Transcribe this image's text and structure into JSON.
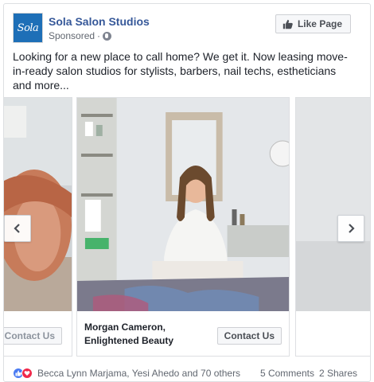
{
  "header": {
    "page_name": "Sola Salon Studios",
    "avatar_text": "Sola",
    "sponsored": "Sponsored",
    "separator": "·",
    "like_page_label": "Like Page"
  },
  "post_text": "Looking for a new place to call home? We get it. Now leasing move-in-ready salon studios for stylists, barbers, nail techs, estheticians and more...",
  "carousel": {
    "cards": [
      {
        "title": "",
        "button": "Contact Us"
      },
      {
        "title": "Morgan Cameron, Enlightened Beauty",
        "button": "Contact Us"
      },
      {
        "title": "",
        "button": ""
      }
    ]
  },
  "icons": {
    "globe": "globe-icon",
    "like": "thumbs-up-icon",
    "prev": "chevron-left-icon",
    "next": "chevron-right-icon"
  },
  "footer": {
    "reaction_names": "Becca Lynn Marjama, Yesi Ahedo and 70 others",
    "comments": "5 Comments",
    "shares": "2 Shares"
  },
  "colors": {
    "brand_link": "#365899",
    "like_blue": "#4a7bf2",
    "love_red": "#f0284a"
  }
}
